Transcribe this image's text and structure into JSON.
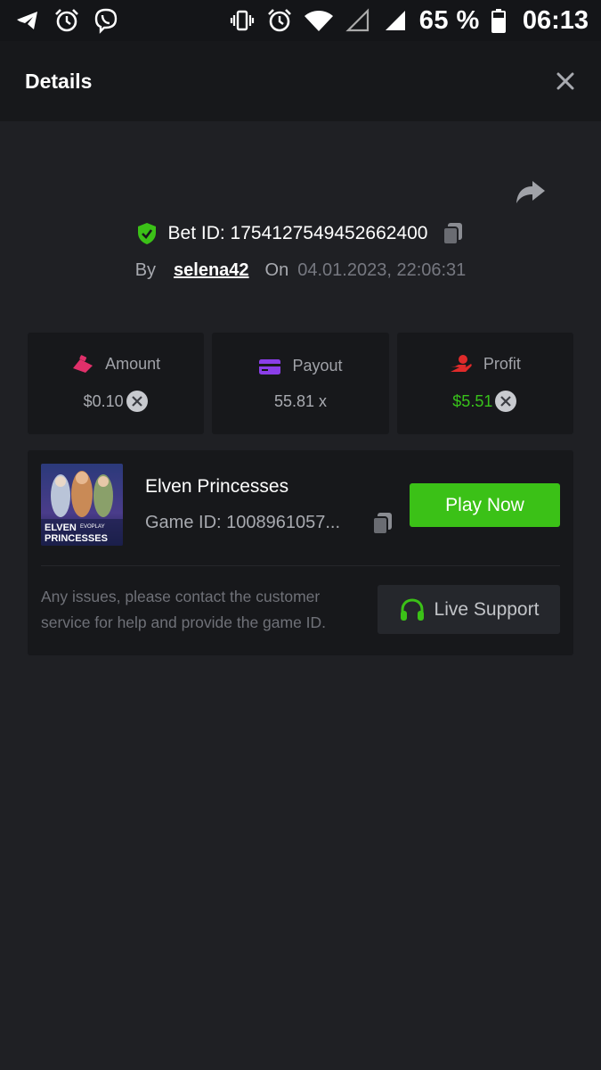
{
  "status_bar": {
    "battery_percent": "65 %",
    "time": "06:13",
    "left_icons": [
      "telegram-icon",
      "alarm-clock-icon",
      "viber-icon"
    ],
    "right_icons": [
      "vibrate-icon",
      "alarm-clock-icon",
      "wifi-icon",
      "signal-empty-icon",
      "signal-icon",
      "battery-icon"
    ]
  },
  "header": {
    "title": "Details",
    "close_icon": "close-icon"
  },
  "bet": {
    "id_label": "Bet ID: 1754127549452662400",
    "by_label": "By",
    "username": "selena42",
    "on_label": "On",
    "date": "04.01.2023, 22:06:31"
  },
  "stats": [
    {
      "label": "Amount",
      "value": "$0.10",
      "icon": "amount-icon",
      "accent": "#e0306a"
    },
    {
      "label": "Payout",
      "value": "55.81 x",
      "icon": "card-icon",
      "accent": "#8a3ee8"
    },
    {
      "label": "Profit",
      "value": "$5.51",
      "icon": "profit-hand-icon",
      "accent": "#e02a2a"
    }
  ],
  "game": {
    "name": "Elven Princesses",
    "id_label": "Game ID: 1008961057...",
    "thumbnail_title_line1": "ELVEN",
    "thumbnail_brand": "EVOPLAY",
    "thumbnail_title_line2": "PRINCESSES",
    "play_button": "Play Now",
    "support_text": "Any issues, please contact the customer service for help and provide the game ID.",
    "support_button": "Live Support"
  },
  "colors": {
    "background": "#1f2024",
    "card": "#17181b",
    "accent_green": "#3bc117",
    "profit_green": "#38c21b",
    "muted_text": "#a8aab0"
  }
}
